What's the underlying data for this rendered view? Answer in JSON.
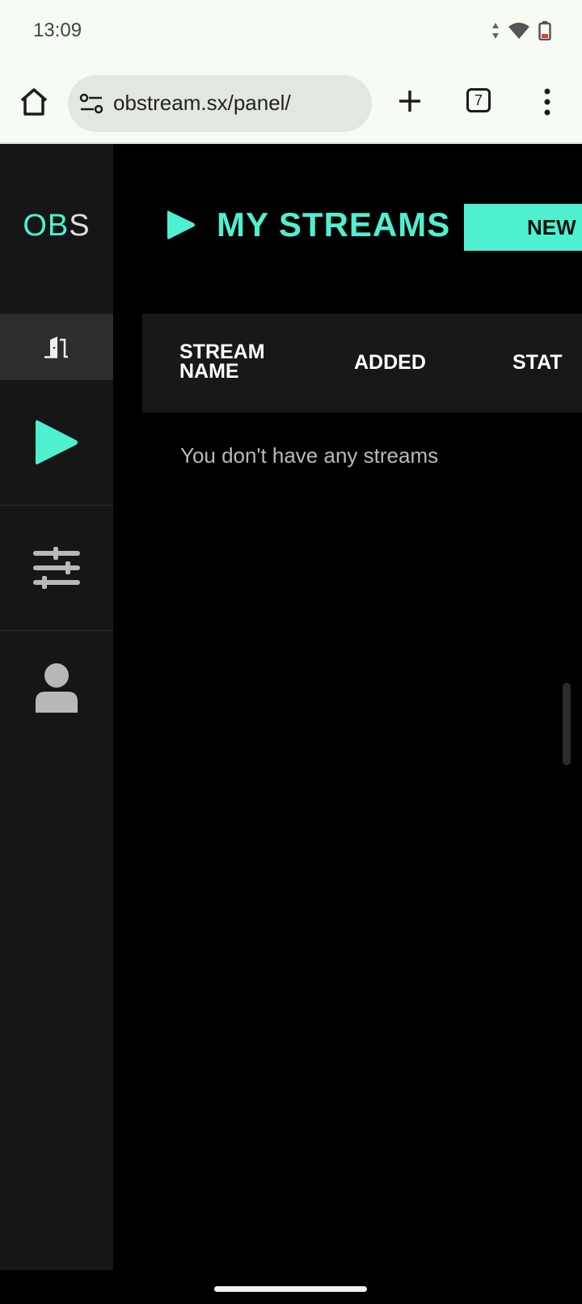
{
  "status_bar": {
    "time": "13:09",
    "icons": [
      "data-arrows-icon",
      "wifi-icon",
      "battery-low-icon"
    ]
  },
  "browser": {
    "url": "obstream.sx/panel/",
    "tab_count": "7",
    "icons": [
      "home-icon",
      "site-settings-icon",
      "plus-icon",
      "tabs-icon",
      "more-vert-icon"
    ]
  },
  "sidebar": {
    "logo_accent": "OB",
    "logo_rest": "S",
    "items": [
      {
        "name": "exit",
        "icon": "exit-door-icon",
        "active": true
      },
      {
        "name": "streams",
        "icon": "play-icon"
      },
      {
        "name": "settings",
        "icon": "sliders-icon"
      },
      {
        "name": "profile",
        "icon": "user-icon"
      }
    ]
  },
  "main": {
    "title": "MY STREAMS",
    "new_button_label": "NEW",
    "table": {
      "columns": [
        "STREAM NAME",
        "ADDED",
        "STAT"
      ]
    },
    "empty_message": "You don't have any streams"
  },
  "colors": {
    "accent": "#4ff0cf",
    "background": "#000000",
    "sidebar": "#161616",
    "browser_chrome": "#f6fbf3"
  }
}
